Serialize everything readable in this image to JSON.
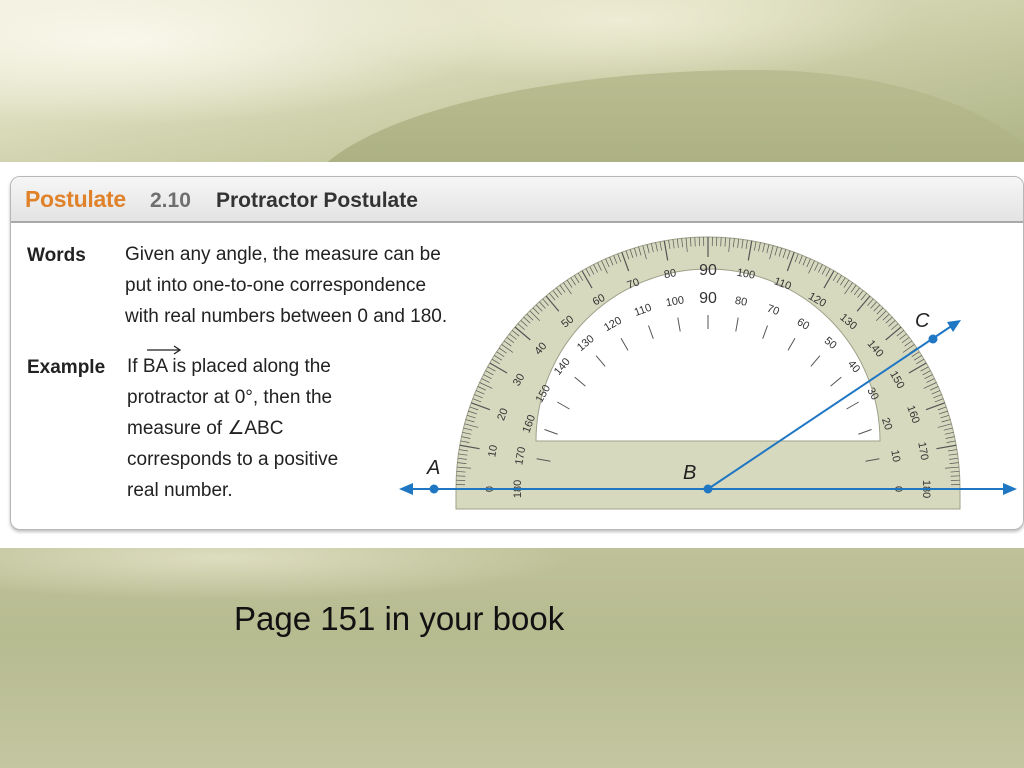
{
  "postulate": {
    "kind": "Postulate",
    "number": "2.10",
    "title": "Protractor Postulate"
  },
  "words": {
    "label": "Words",
    "lines": [
      "Given any angle, the measure can be",
      "put into one-to-one correspondence",
      "with real numbers between 0 and 180."
    ]
  },
  "example": {
    "label": "Example",
    "lines": [
      "If BA is placed along the",
      "protractor at 0°, then the",
      "measure of ∠ABC",
      "corresponds to a positive",
      "real number."
    ]
  },
  "diagram": {
    "points": {
      "A": "A",
      "B": "B",
      "C": "C"
    },
    "outer_scale": [
      "0",
      "10",
      "20",
      "30",
      "40",
      "50",
      "60",
      "70",
      "80",
      "90",
      "100",
      "110",
      "120",
      "130",
      "140",
      "150",
      "160",
      "170",
      "180"
    ],
    "inner_scale": [
      "180",
      "170",
      "160",
      "150",
      "140",
      "130",
      "120",
      "110",
      "100",
      "90",
      "80",
      "70",
      "60",
      "50",
      "40",
      "30",
      "20",
      "10",
      "0"
    ],
    "ray_color": "#1f77c4",
    "protractor_color": "#d7d9bf"
  },
  "footer": {
    "text": "Page 151 in your book"
  }
}
